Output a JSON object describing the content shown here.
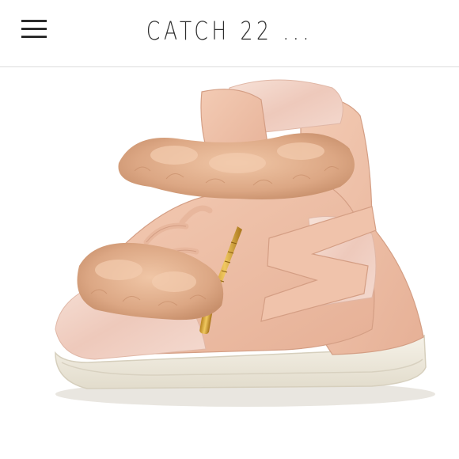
{
  "header": {
    "title": "CATCH 22 ..."
  },
  "icons": {
    "menu": "hamburger-menu-icon"
  },
  "photo": {
    "subject": "product-photo",
    "colors": {
      "leather": "#eec1a9",
      "fur": "#e2b08e",
      "velvet": "#f3d8cd",
      "sole": "#f1ece0",
      "zipper": "#d8a53a"
    }
  }
}
